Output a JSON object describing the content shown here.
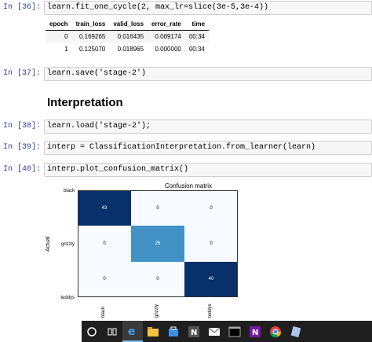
{
  "cells": [
    {
      "prompt": "In [36]:",
      "code": "learn.fit_one_cycle(2, max_lr=slice(3e-5,3e-4))"
    },
    {
      "prompt": "In [37]:",
      "code": "learn.save('stage-2')"
    },
    {
      "prompt": "In [38]:",
      "code": "learn.load('stage-2');"
    },
    {
      "prompt": "In [39]:",
      "code": "interp = ClassificationInterpretation.from_learner(learn)"
    },
    {
      "prompt": "In [40]:",
      "code": "interp.plot_confusion_matrix()"
    }
  ],
  "results_table": {
    "headers": [
      "epoch",
      "train_loss",
      "valid_loss",
      "error_rate",
      "time"
    ],
    "rows": [
      [
        "0",
        "0.169265",
        "0.016435",
        "0.009174",
        "00:34"
      ],
      [
        "1",
        "0.125070",
        "0.018965",
        "0.000000",
        "00:34"
      ]
    ]
  },
  "section_heading": "Interpretation",
  "confusion_matrix": {
    "title": "Confusion matrix",
    "ylabel": "Actual",
    "classes": [
      "black",
      "grizzly",
      "teddys"
    ],
    "values": [
      [
        "43",
        "0",
        "0"
      ],
      [
        "0",
        "26",
        "0"
      ],
      [
        "0",
        "0",
        "40"
      ]
    ],
    "colors": {
      "high": "#08306b",
      "mid": "#4292c6",
      "zero": "#f7fbff"
    }
  },
  "taskbar_icons": [
    "cortana-icon",
    "task-view-icon",
    "edge-icon",
    "file-explorer-icon",
    "store-icon",
    "notion-icon",
    "mail-icon",
    "terminal-icon",
    "onenote-icon",
    "chrome-icon",
    "app-icon"
  ]
}
